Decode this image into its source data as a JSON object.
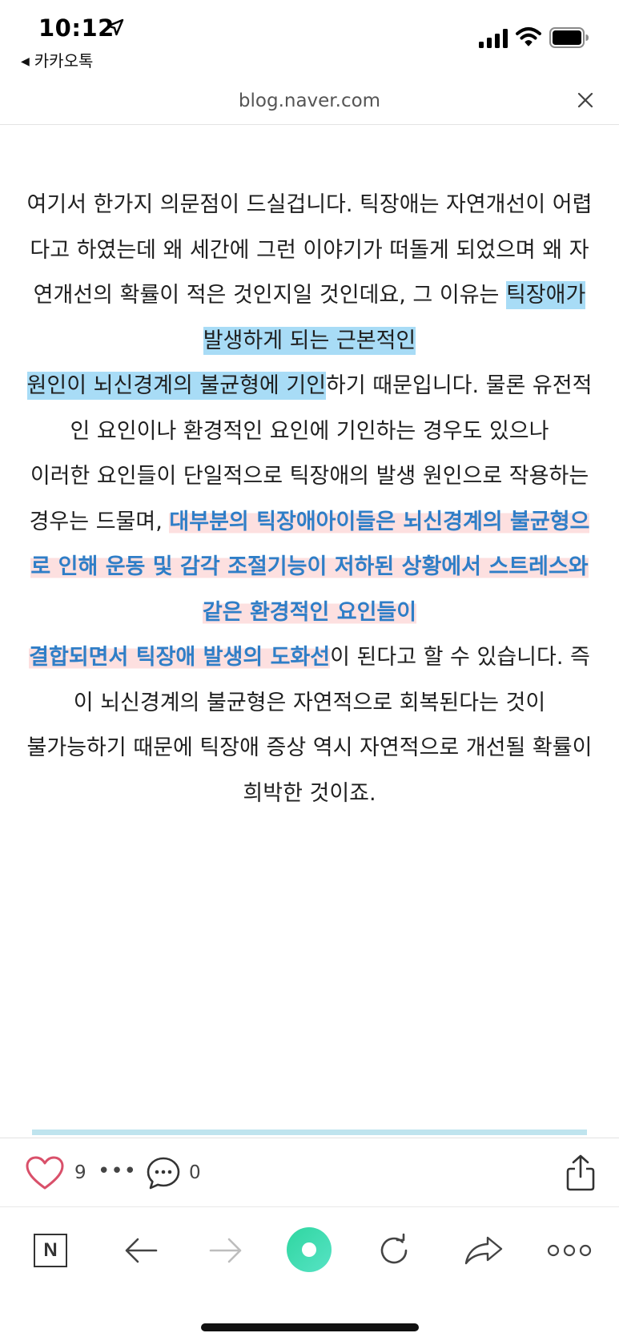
{
  "status_bar": {
    "time": "10:12",
    "back_app_arrow": "◀",
    "back_app": "카카오톡"
  },
  "url_bar": {
    "url": "blog.naver.com",
    "close_icon": "close-icon"
  },
  "article": {
    "p1_a": "여기서 한가지 의문점이 드실겁니다. 틱장애는 자연개선이 어렵다고 하였는데 왜 세간에 그런 이야기가 떠돌게 되었으며 왜 자연개선의 확률이 적은 것인지일 것인데요, 그 이유는 ",
    "p1_hl": "틱장애가 발생하게 되는 근본적인",
    "p2_hl": "원인이 뇌신경계의 불균형에 기인",
    "p2_b": "하기 때문입니다. 물론 유전적인 요인이나 환경적인 요인에 기인하는 경우도 있으나",
    "p3_a": "이러한 요인들이 단일적으로 틱장애의 발생 원인으로 작용하는 경우는 드물며, ",
    "p3_hl": "대부분의 틱장애아이들은 뇌신경계의 불균형으로 인해 운동 및 감각 조절기능이 저하된 상황에서 스트레스와 같은 환경적인 요인들이",
    "p4_hl": "결합되면서 틱장애 발생의 도화선",
    "p4_b": "이 된다고 할 수 있습니다. 즉 이 뇌신경계의 불균형은 자연적으로 회복된다는 것이",
    "p5": "불가능하기 때문에 틱장애 증상 역시 자연적으로 개선될 확률이 희박한 것이죠."
  },
  "social": {
    "likes": "9",
    "more": "•••",
    "comments": "0"
  },
  "nav": {
    "naver_label": "N",
    "more_label": "ooo"
  },
  "colors": {
    "highlight_blue": "#a8dcf6",
    "emphasis_text": "#2f7ec7",
    "emphasis_marker": "#fcd6d6",
    "home_gradient_start": "#2fd6a0",
    "home_gradient_end": "#57e3c5"
  }
}
